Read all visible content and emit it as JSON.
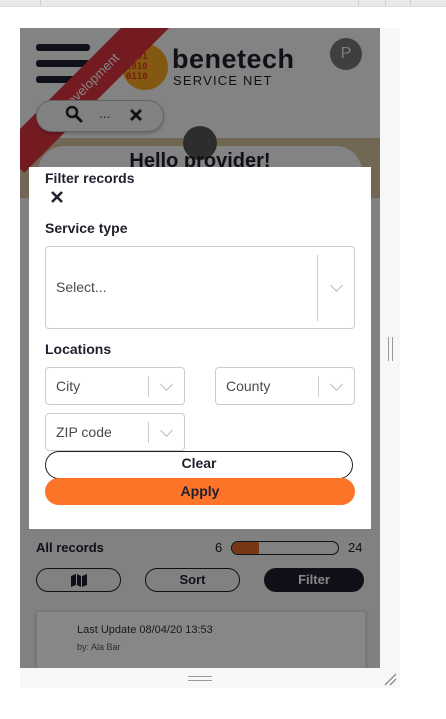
{
  "header": {
    "ribbon_text": "Development",
    "brand_name": "benetech",
    "brand_sub": "SERVICE NET",
    "logo_bits": "0101\n1010\n0110",
    "avatar_initial": "P",
    "search_value": "...",
    "welcome": "Hello provider!"
  },
  "filter_modal": {
    "title": "Filter records",
    "close_glyph": "✕",
    "service_type_label": "Service type",
    "service_type_placeholder": "Select...",
    "locations_label": "Locations",
    "city_placeholder": "City",
    "county_placeholder": "County",
    "zip_placeholder": "ZIP code",
    "clear_label": "Clear",
    "apply_label": "Apply"
  },
  "records": {
    "all_records_label": "All records",
    "shown_count": "6",
    "total_count": "24",
    "progress_fraction": 0.25,
    "map_icon": "map-icon",
    "sort_label": "Sort",
    "filter_label": "Filter",
    "first_card": {
      "last_update": "Last Update 08/04/20 13:53",
      "by": "by: Ala Bar"
    }
  },
  "colors": {
    "accent_orange": "#fd7327",
    "navy": "#1f1f2e",
    "dev_ribbon": "#d9333f"
  }
}
